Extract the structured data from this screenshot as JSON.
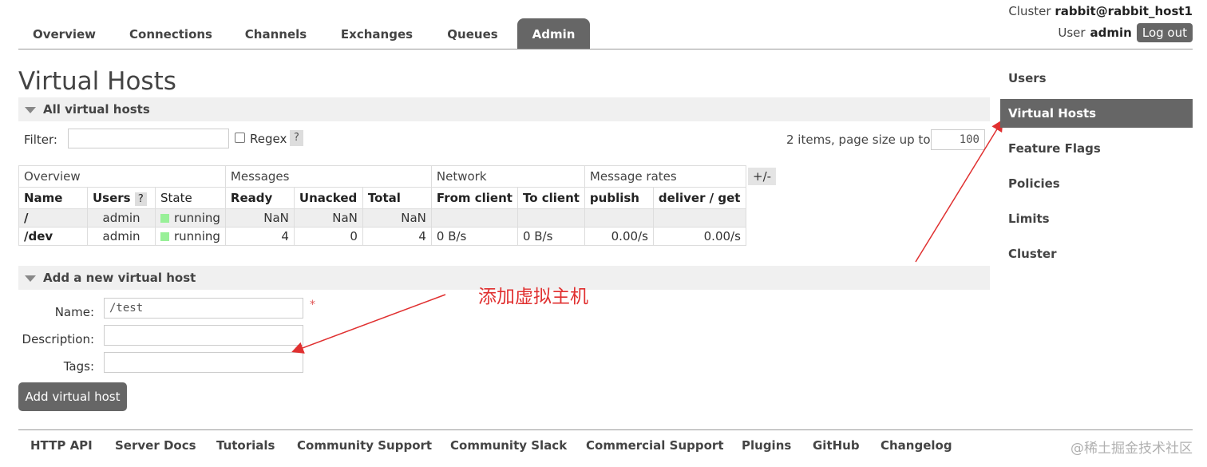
{
  "nav": {
    "tabs": [
      "Overview",
      "Connections",
      "Channels",
      "Exchanges",
      "Queues",
      "Admin"
    ],
    "active": "Admin"
  },
  "header": {
    "cluster_label": "Cluster",
    "cluster_name": "rabbit@rabbit_host1",
    "user_label": "User",
    "user_name": "admin",
    "logout": "Log out"
  },
  "page": {
    "title": "Virtual Hosts",
    "all_section": "All virtual hosts",
    "add_section": "Add a new virtual host"
  },
  "filter": {
    "label": "Filter:",
    "value": "",
    "regex_label": "Regex",
    "regex_checked": false,
    "help": "?",
    "items_text": "2 items, page size up to",
    "page_size": "100"
  },
  "table": {
    "groups": [
      "Overview",
      "Messages",
      "Network",
      "Message rates"
    ],
    "columns": [
      "Name",
      "Users",
      "State",
      "Ready",
      "Unacked",
      "Total",
      "From client",
      "To client",
      "publish",
      "deliver / get"
    ],
    "users_help": "?",
    "rows": [
      {
        "name": "/",
        "users": "admin",
        "state": "running",
        "ready": "NaN",
        "unacked": "NaN",
        "total": "NaN",
        "from_client": "",
        "to_client": "",
        "publish": "",
        "deliver_get": ""
      },
      {
        "name": "/dev",
        "users": "admin",
        "state": "running",
        "ready": "4",
        "unacked": "0",
        "total": "4",
        "from_client": "0 B/s",
        "to_client": "0 B/s",
        "publish": "0.00/s",
        "deliver_get": "0.00/s"
      }
    ],
    "plus_minus": "+/-",
    "running_color": "#98f098"
  },
  "form": {
    "name_label": "Name:",
    "name_value": "/test",
    "required_mark": "*",
    "description_label": "Description:",
    "description_value": "",
    "tags_label": "Tags:",
    "tags_value": "",
    "submit": "Add virtual host"
  },
  "annotation": "添加虚拟主机",
  "sidebar": {
    "items": [
      "Users",
      "Virtual Hosts",
      "Feature Flags",
      "Policies",
      "Limits",
      "Cluster"
    ],
    "active": "Virtual Hosts"
  },
  "footer": {
    "links": [
      "HTTP API",
      "Server Docs",
      "Tutorials",
      "Community Support",
      "Community Slack",
      "Commercial Support",
      "Plugins",
      "GitHub",
      "Changelog"
    ]
  },
  "watermark": "@稀土掘金技术社区",
  "colors": {
    "accent": "#666666",
    "annotation": "#e03030"
  }
}
